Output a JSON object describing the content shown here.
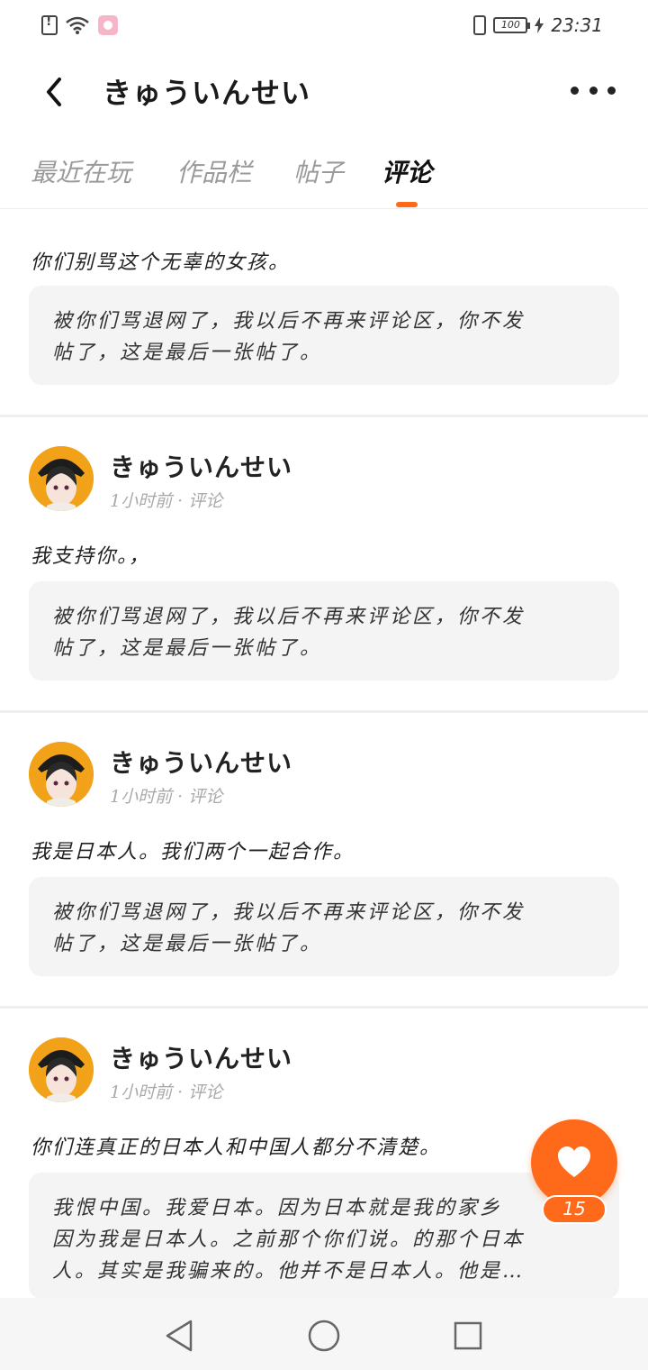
{
  "status_bar": {
    "time": "23:31",
    "battery": "100",
    "icons": [
      "sim-alert-icon",
      "wifi-icon",
      "app-notification-icon",
      "vibrate-icon",
      "battery-icon",
      "charging-icon"
    ]
  },
  "header": {
    "title": "きゅういんせい",
    "back_icon": "chevron-left-icon",
    "more_icon": "more-dots-icon"
  },
  "tabs": [
    {
      "label": "最近在玩",
      "active": false
    },
    {
      "label": "作品栏",
      "active": false
    },
    {
      "label": "帖子",
      "active": false
    },
    {
      "label": "评论",
      "active": true
    }
  ],
  "posts": [
    {
      "text": "你们别骂这个无辜的女孩。",
      "quote_lines": [
        "被你们骂退网了，我以后不再来评论区，你不发",
        "帖了，这是最后一张帖了。"
      ]
    },
    {
      "username": "きゅういんせい",
      "meta": "1小时前 · 评论",
      "text": "我支持你。，",
      "quote_lines": [
        "被你们骂退网了，我以后不再来评论区，你不发",
        "帖了，这是最后一张帖了。"
      ]
    },
    {
      "username": "きゅういんせい",
      "meta": "1小时前 · 评论",
      "text": "我是日本人。我们两个一起合作。",
      "quote_lines": [
        "被你们骂退网了，我以后不再来评论区，你不发",
        "帖了，这是最后一张帖了。"
      ]
    },
    {
      "username": "きゅういんせい",
      "meta": "1小时前 · 评论",
      "text": "你们连真正的日本人和中国人都分不清楚。",
      "quote_lines": [
        "我恨中国。我爱日本。因为日本就是我的家乡",
        "因为我是日本人。之前那个你们说。的那个日本",
        "人。其实是我骗来的。他并不是日本人。他是…"
      ]
    }
  ],
  "like": {
    "icon": "heart-icon",
    "count": "15",
    "color": "#ff6a1a"
  },
  "nav_bar": {
    "icons": [
      "back-triangle-icon",
      "home-circle-icon",
      "recents-square-icon"
    ]
  },
  "colors": {
    "accent": "#ff6a1a",
    "quote_bg": "#f4f4f4",
    "meta_text": "#aaaaaa"
  }
}
